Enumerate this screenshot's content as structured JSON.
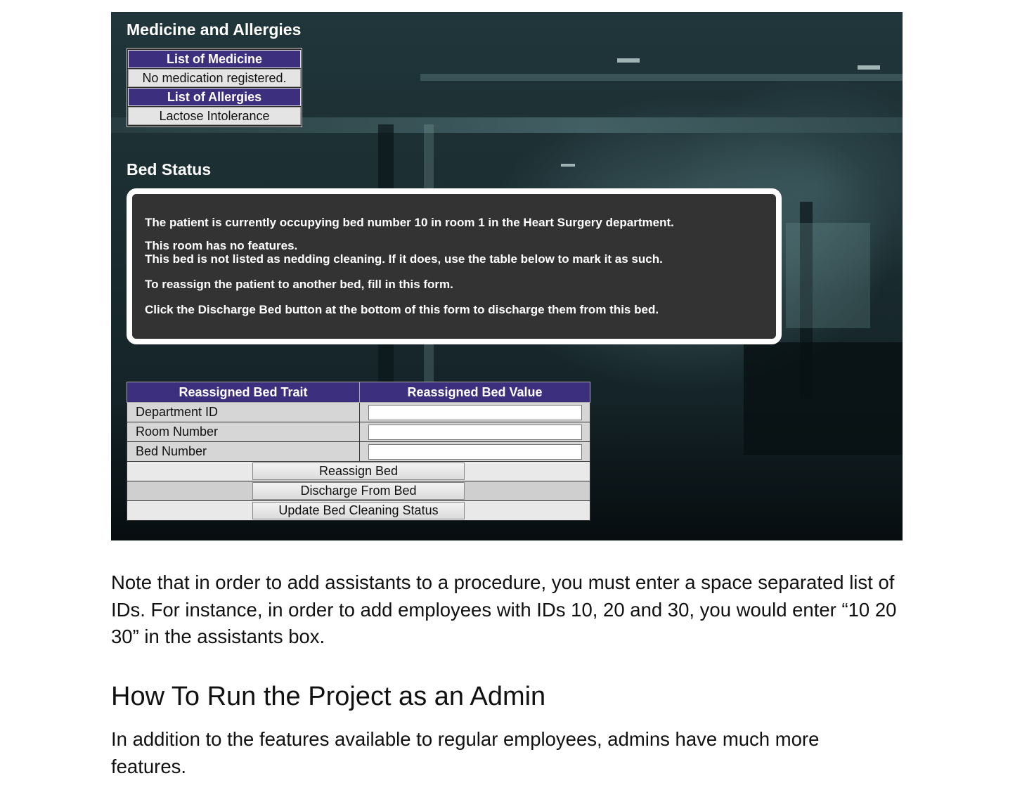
{
  "screenshot": {
    "medicine_section": {
      "title": "Medicine and Allergies",
      "medicine_header": "List of Medicine",
      "medicine_value": "No medication registered.",
      "allergies_header": "List of Allergies",
      "allergies_value": "Lactose Intolerance"
    },
    "bed_status": {
      "title": "Bed Status",
      "line1": "The patient is currently occupying bed number 10 in room 1 in the Heart Surgery department.",
      "line2": "This room has no features.",
      "line3": "This bed is not listed as nedding cleaning. If it does, use the table below to mark it as such.",
      "line4": "To reassign the patient to another bed, fill in this form.",
      "line5": "Click the Discharge Bed button at the bottom of this form to discharge them from this bed."
    },
    "reassign_table": {
      "col_trait": "Reassigned Bed Trait",
      "col_value": "Reassigned Bed Value",
      "rows": [
        {
          "label": "Department ID",
          "value": ""
        },
        {
          "label": "Room Number",
          "value": ""
        },
        {
          "label": "Bed Number",
          "value": ""
        }
      ],
      "buttons": {
        "reassign": "Reassign Bed",
        "discharge": "Discharge From Bed",
        "cleaning": "Update Bed Cleaning Status"
      }
    }
  },
  "document": {
    "note": "Note that in order to add assistants to a procedure, you must enter a space separated list of IDs. For instance, in order to add employees with IDs 10, 20 and 30, you would enter “10 20 30” in the assistants box.",
    "heading": "How To Run the Project as an Admin",
    "paragraph": "In addition to the features available to regular employees, admins have much more features."
  }
}
